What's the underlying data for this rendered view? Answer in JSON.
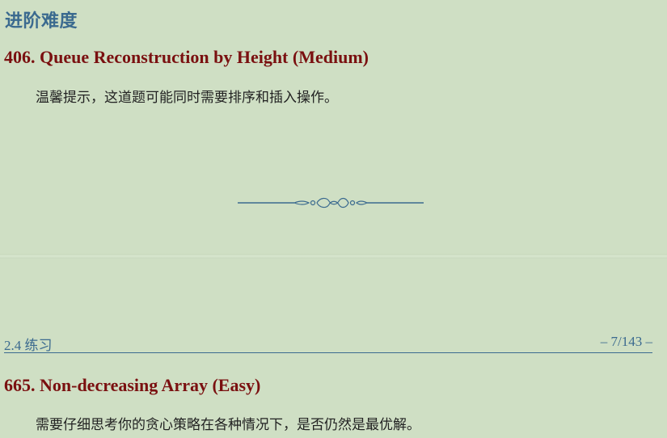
{
  "page1": {
    "section_title": "进阶难度",
    "problem_title": "406. Queue Reconstruction by Height (Medium)",
    "hint": "温馨提示，这道题可能同时需要排序和插入操作。"
  },
  "footer": {
    "section_label": "2.4 练习",
    "page_number": "– 7/143 –"
  },
  "page2": {
    "problem_title": "665. Non-decreasing Array (Easy)",
    "hint": "需要仔细思考你的贪心策略在各种情况下，是否仍然是最优解。"
  }
}
